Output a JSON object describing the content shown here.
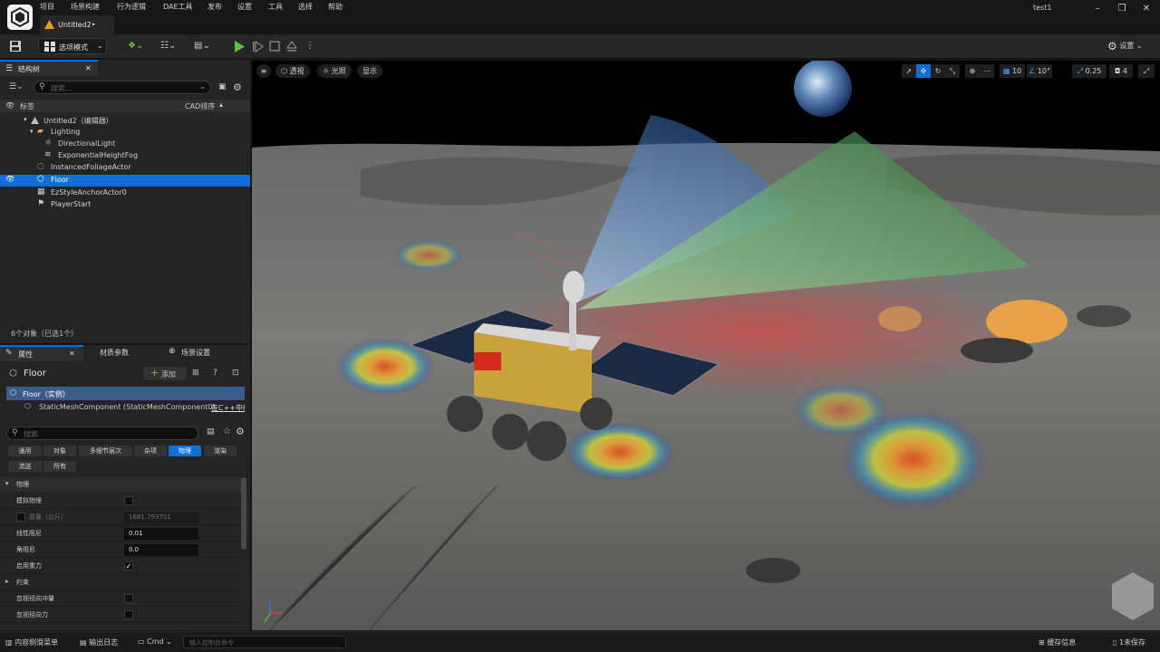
{
  "menubar": {
    "items": [
      "项目",
      "场景构建",
      "行为逻辑",
      "DAE工具",
      "发布",
      "设置",
      "工具",
      "选择",
      "帮助"
    ],
    "project": "test1"
  },
  "document_tab": {
    "label": "Untitled2•"
  },
  "toolbar": {
    "mode_label": "选项模式",
    "settings_label": "设置"
  },
  "outliner": {
    "tab_label": "结构树",
    "search_placeholder": "搜索...",
    "col_label": "标签",
    "col_sort": "CAD排序",
    "items": [
      {
        "label": "Untitled2（编辑器）",
        "depth": 0
      },
      {
        "label": "Lighting",
        "depth": 1
      },
      {
        "label": "DirectionalLight",
        "depth": 2
      },
      {
        "label": "ExponentialHeightFog",
        "depth": 2
      },
      {
        "label": "InstancedFoliageActor",
        "depth": 1
      },
      {
        "label": "Floor",
        "depth": 1
      },
      {
        "label": "EzStyleAnchorActor0",
        "depth": 1
      },
      {
        "label": "PlayerStart",
        "depth": 1
      }
    ],
    "status": "6个对象（已选1个）"
  },
  "details": {
    "tabs": [
      "属性",
      "材质参数",
      "场景设置"
    ],
    "object_name": "Floor",
    "add_label": "添加",
    "instance_label": "Floor（实例）",
    "component_label": "StaticMeshComponent (StaticMeshComponent0)",
    "component_link": "在C++中编",
    "search_placeholder": "搜索",
    "chips": [
      "通用",
      "对象",
      "多细节层次",
      "杂项",
      "物理",
      "渲染",
      "流送",
      "所有"
    ],
    "section": "物理",
    "props": [
      {
        "label": "模拟物理",
        "type": "check",
        "checked": false
      },
      {
        "label": "质量（公斤）",
        "type": "value",
        "value": "1681.793701",
        "disabled": true
      },
      {
        "label": "线性阻尼",
        "type": "value",
        "value": "0.01"
      },
      {
        "label": "角阻尼",
        "type": "value",
        "value": "0.0"
      },
      {
        "label": "启用重力",
        "type": "check",
        "checked": true
      }
    ],
    "subsection": "约束",
    "props2": [
      {
        "label": "忽视径向冲量",
        "type": "check",
        "checked": false
      },
      {
        "label": "忽视径向力",
        "type": "check",
        "checked": false
      }
    ]
  },
  "viewport": {
    "perspective": "透视",
    "lighting": "光照",
    "show": "显示",
    "grid": "10",
    "angle": "10°",
    "scale": "0.25",
    "cams": "4"
  },
  "bottombar": {
    "content_drawer": "内容侧滑菜单",
    "output_log": "输出日志",
    "cmd": "Cmd",
    "cmd_placeholder": "输入控制台命令",
    "derived": "缓存信息",
    "unsaved": "1未保存"
  }
}
